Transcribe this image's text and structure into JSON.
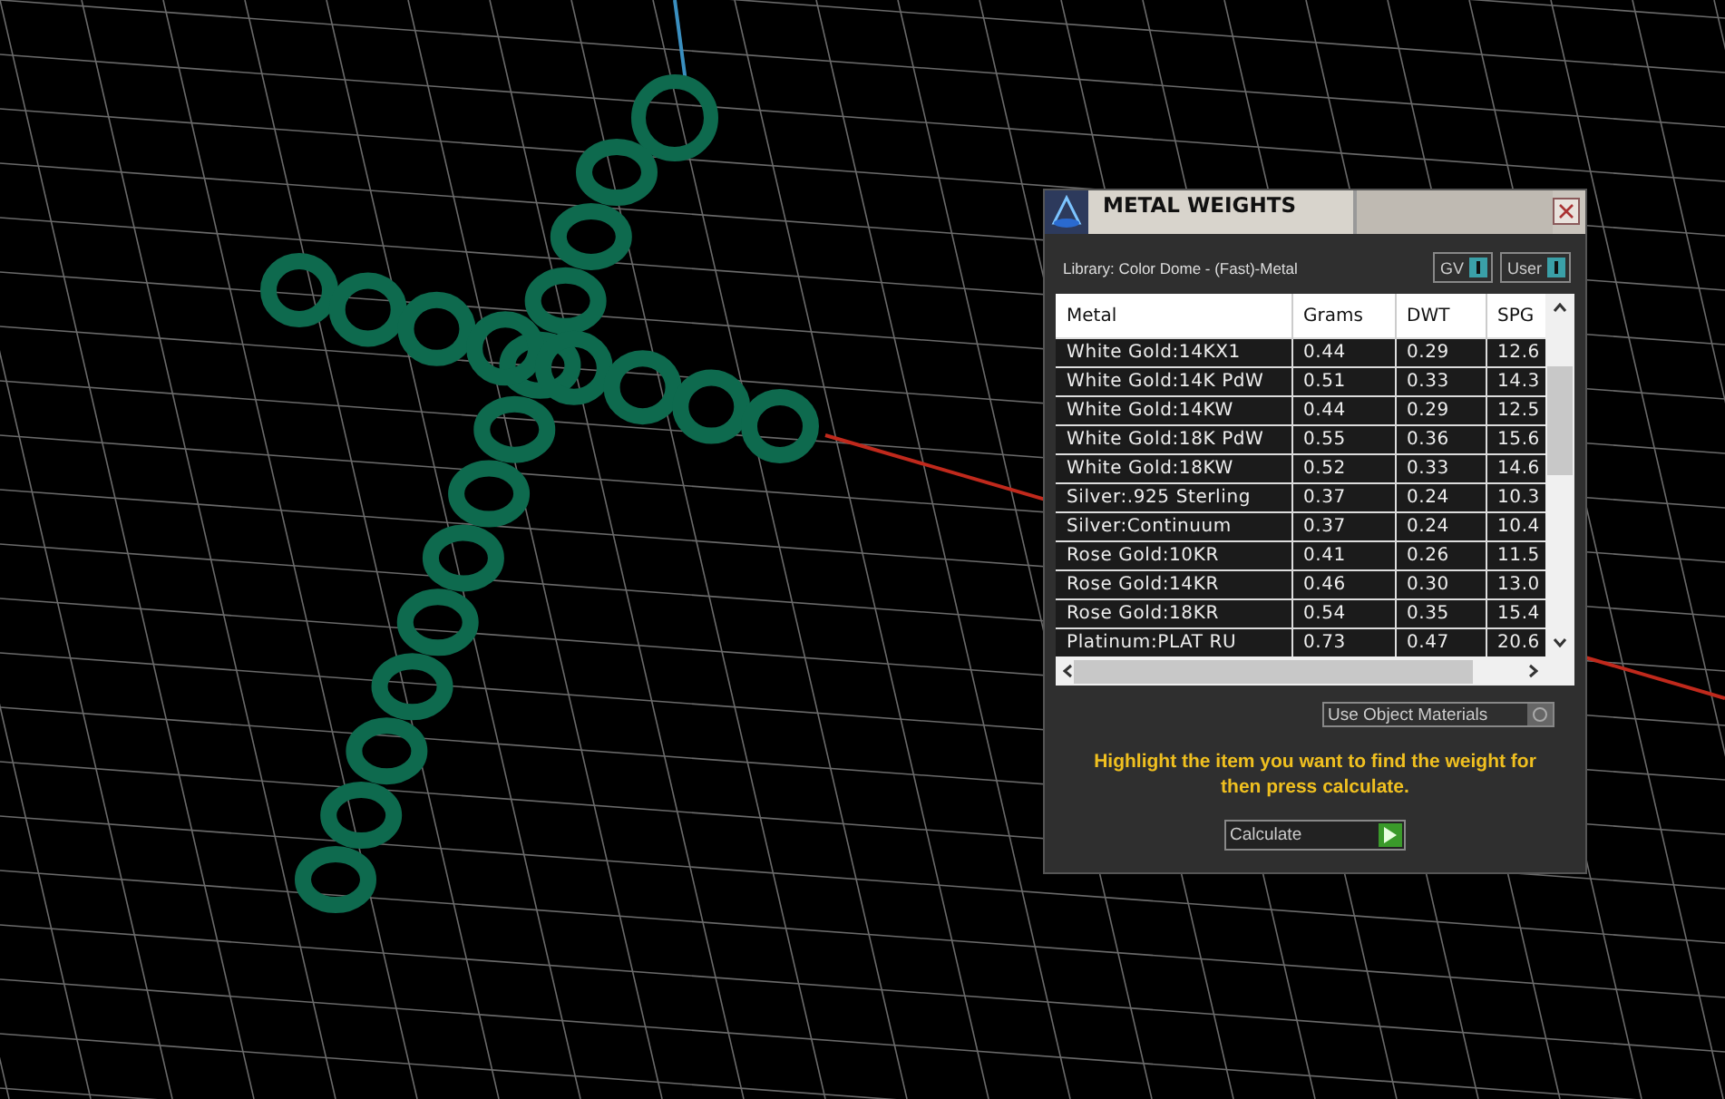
{
  "window": {
    "title": "METAL WEIGHTS"
  },
  "library": {
    "label": "Library: Color Dome - (Fast)-Metal"
  },
  "toggles": [
    {
      "label": "GV",
      "on": true
    },
    {
      "label": "User",
      "on": true
    }
  ],
  "table": {
    "columns": [
      "Metal",
      "Grams",
      "DWT",
      "SPG"
    ],
    "rows": [
      [
        "White Gold:14KX1",
        "0.44",
        "0.29",
        "12.6"
      ],
      [
        "White Gold:14K PdW",
        "0.51",
        "0.33",
        "14.3"
      ],
      [
        "White Gold:14KW",
        "0.44",
        "0.29",
        "12.5"
      ],
      [
        "White Gold:18K PdW",
        "0.55",
        "0.36",
        "15.6"
      ],
      [
        "White Gold:18KW",
        "0.52",
        "0.33",
        "14.6"
      ],
      [
        "Silver:.925 Sterling",
        "0.37",
        "0.24",
        "10.3"
      ],
      [
        "Silver:Continuum",
        "0.37",
        "0.24",
        "10.4"
      ],
      [
        "Rose Gold:10KR",
        "0.41",
        "0.26",
        "11.5"
      ],
      [
        "Rose Gold:14KR",
        "0.46",
        "0.30",
        "13.0"
      ],
      [
        "Rose Gold:18KR",
        "0.54",
        "0.35",
        "15.4"
      ],
      [
        "Platinum:PLAT RU",
        "0.73",
        "0.47",
        "20.6"
      ]
    ]
  },
  "use_object_materials": {
    "label": "Use Object Materials"
  },
  "hint": "Highlight the item you want to find the weight for then press calculate.",
  "calculate_button": {
    "label": "Calculate"
  }
}
